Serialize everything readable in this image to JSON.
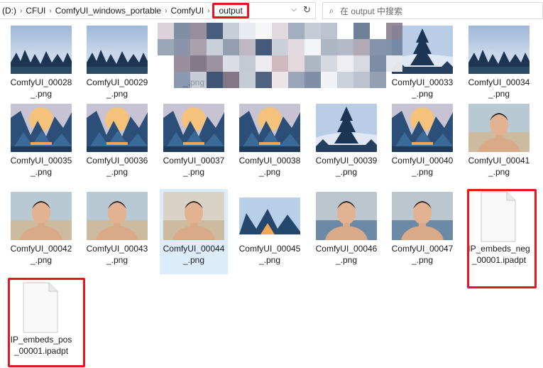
{
  "address": {
    "drive": "(D:)",
    "crumbs": [
      "CFUI",
      "ComfyUI_windows_portable",
      "ComfyUI"
    ],
    "current": "output",
    "refresh_icon": "refresh-icon"
  },
  "search": {
    "placeholder": "在 output 中搜索"
  },
  "colors": {
    "highlight": "#e8141f",
    "selection": "#dcecfb"
  },
  "files": [
    {
      "line1": "ComfyUI_00028",
      "line2": "_.png",
      "art": "forest"
    },
    {
      "line1": "ComfyUI_00029",
      "line2": "_.png",
      "art": "forest"
    },
    {
      "line1": "",
      "line2": "_.png",
      "art": "blurred"
    },
    {
      "line1": "",
      "line2": "",
      "art": "blurred"
    },
    {
      "line1": "",
      "line2": "",
      "art": "blurred"
    },
    {
      "line1": "ComfyUI_00033",
      "line2": "_.png",
      "art": "tree"
    },
    {
      "line1": "ComfyUI_00034",
      "line2": "_.png",
      "art": "forest"
    },
    {
      "line1": "ComfyUI_00035",
      "line2": "_.png",
      "art": "mountain-sun"
    },
    {
      "line1": "ComfyUI_00036",
      "line2": "_.png",
      "art": "mountain-sun"
    },
    {
      "line1": "ComfyUI_00037",
      "line2": "_.png",
      "art": "mountain-sun"
    },
    {
      "line1": "ComfyUI_00038",
      "line2": "_.png",
      "art": "mountain-sun"
    },
    {
      "line1": "ComfyUI_00039",
      "line2": "_.png",
      "art": "tree"
    },
    {
      "line1": "ComfyUI_00040",
      "line2": "_.png",
      "art": "mountain-sun"
    },
    {
      "line1": "ComfyUI_00041",
      "line2": "_.png",
      "art": "portrait-beach"
    },
    {
      "line1": "ComfyUI_00042",
      "line2": "_.png",
      "art": "portrait-beach"
    },
    {
      "line1": "ComfyUI_00043",
      "line2": "_.png",
      "art": "portrait-beach"
    },
    {
      "line1": "ComfyUI_00044",
      "line2": "_.png",
      "art": "portrait-light"
    },
    {
      "line1": "ComfyUI_00045",
      "line2": "_.png",
      "art": "mountain"
    },
    {
      "line1": "ComfyUI_00046",
      "line2": "_.png",
      "art": "portrait-mountain"
    },
    {
      "line1": "ComfyUI_00047",
      "line2": "_.png",
      "art": "portrait-mountain"
    },
    {
      "line1": "IP_embeds_neg",
      "line2": "_00001.ipadpt",
      "art": "file"
    },
    {
      "line1": "IP_embeds_pos",
      "line2": "_00001.ipadpt",
      "art": "file"
    }
  ],
  "selected_file": "ComfyUI_00044"
}
